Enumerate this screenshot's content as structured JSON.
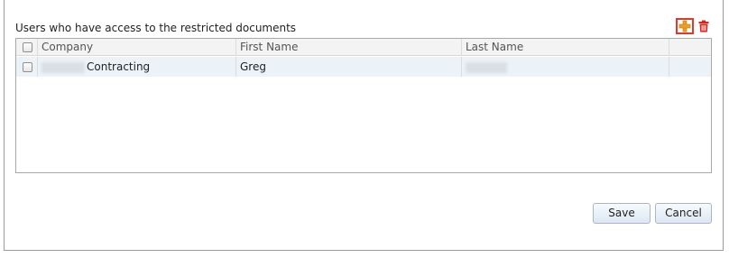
{
  "section": {
    "title": "Users who have access to the restricted documents"
  },
  "toolbar": {
    "add_icon": "plus-icon",
    "delete_icon": "trash-icon",
    "colors": {
      "add": "#f0a020",
      "add_border": "#e03a2a",
      "delete": "#d9251c"
    }
  },
  "grid": {
    "columns": [
      "Company",
      "First Name",
      "Last Name"
    ],
    "rows": [
      {
        "company": "Contracting",
        "first_name": "Greg",
        "last_name": ""
      }
    ],
    "row_color": "#ecf3f8"
  },
  "buttons": {
    "save": "Save",
    "cancel": "Cancel"
  }
}
